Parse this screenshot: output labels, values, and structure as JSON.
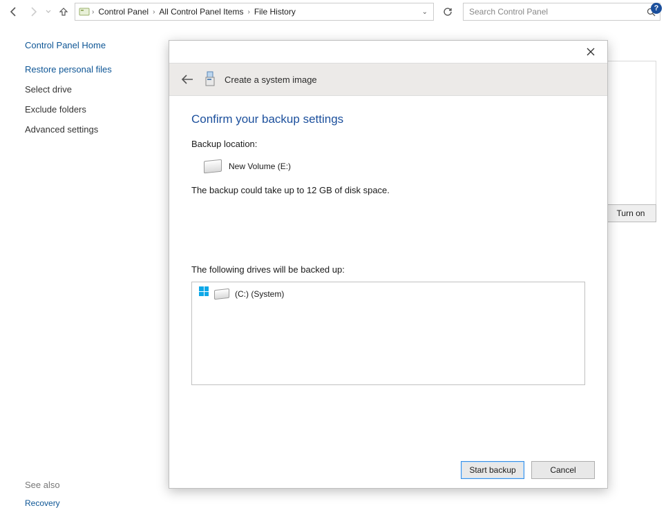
{
  "breadcrumb": {
    "items": [
      "Control Panel",
      "All Control Panel Items",
      "File History"
    ]
  },
  "search": {
    "placeholder": "Search Control Panel"
  },
  "sidebar": {
    "home": "Control Panel Home",
    "links": [
      "Restore personal files",
      "Select drive",
      "Exclude folders",
      "Advanced settings"
    ],
    "see_also_label": "See also",
    "see_also_link": "Recovery"
  },
  "background": {
    "turn_on": "Turn on"
  },
  "dialog": {
    "wizard_title": "Create a system image",
    "heading": "Confirm your backup settings",
    "location_label": "Backup location:",
    "location_value": "New Volume (E:)",
    "size_line": "The backup could take up to 12 GB of disk space.",
    "drive_list_label": "The following drives will be backed up:",
    "drives": [
      "(C:) (System)"
    ],
    "start": "Start backup",
    "cancel": "Cancel"
  }
}
